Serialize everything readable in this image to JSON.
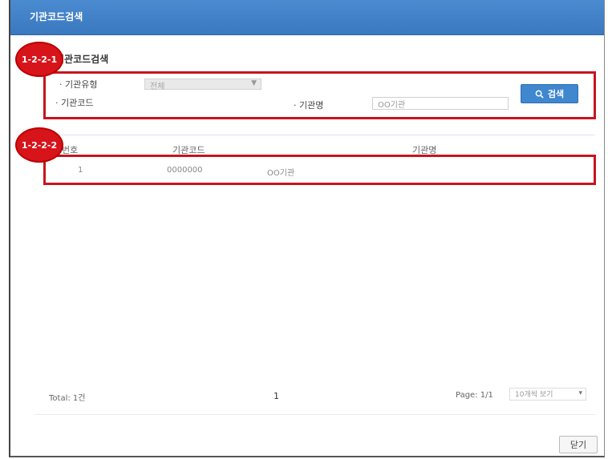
{
  "window": {
    "title": "기관코드검색"
  },
  "search_section": {
    "title": "기관코드검색",
    "badge": "1-2-2-1",
    "type_label": "· 기관유형",
    "type_value": "전체",
    "code_label": "· 기관코드",
    "name_label": "· 기관명",
    "name_value": "OO기관",
    "search_button": "검색"
  },
  "results": {
    "badge": "1-2-2-2",
    "columns": [
      "번호",
      "기관코드",
      "기관명"
    ],
    "rows": [
      {
        "no": "1",
        "code": "0000000",
        "name": "OO기관"
      }
    ]
  },
  "pagination": {
    "total_label": "Total: 1건",
    "current_page": "1",
    "page_label": "Page: 1/1",
    "page_size": "10개씩 보기"
  },
  "footer": {
    "close_button": "닫기"
  }
}
